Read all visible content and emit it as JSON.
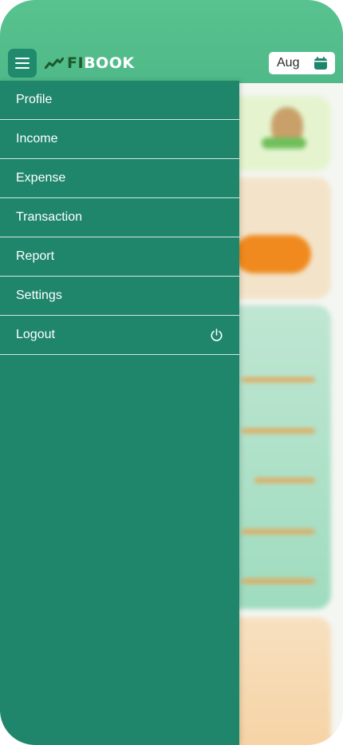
{
  "header": {
    "menu_icon": "hamburger-menu-icon",
    "logo": {
      "part1": "FI",
      "part2": "BOOK",
      "icon": "trend-line-icon"
    },
    "month_selector": {
      "value": "Aug",
      "icon": "calendar-icon"
    }
  },
  "drawer": {
    "items": [
      {
        "label": "Profile"
      },
      {
        "label": "Income"
      },
      {
        "label": "Expense"
      },
      {
        "label": "Transaction"
      },
      {
        "label": "Report"
      },
      {
        "label": "Settings"
      },
      {
        "label": "Logout",
        "icon": "power-icon"
      }
    ]
  },
  "colors": {
    "header": "#58c38e",
    "drawer": "#1f866c",
    "accent_orange": "#f08a1e"
  }
}
